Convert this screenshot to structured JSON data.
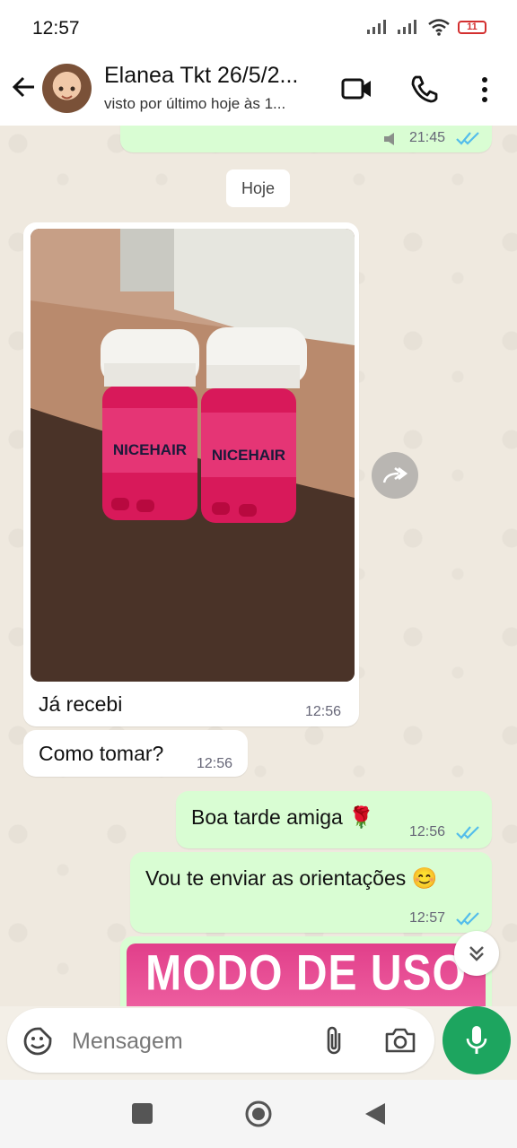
{
  "status_bar": {
    "time": "12:57",
    "battery": "11",
    "icons": [
      "signal-icon",
      "signal-icon",
      "wifi-icon",
      "battery-icon"
    ]
  },
  "header": {
    "contact_name": "Elanea Tkt 26/5/2...",
    "contact_status": "visto por último hoje às 1...",
    "icons": [
      "back-arrow-icon",
      "video-call-icon",
      "phone-icon",
      "more-vert-icon"
    ]
  },
  "chat": {
    "previous_message_time": "21:45",
    "date_separator": "Hoje",
    "messages": [
      {
        "direction": "in",
        "type": "image",
        "caption": "Já recebi",
        "time": "12:56"
      },
      {
        "direction": "in",
        "text": "Como tomar?",
        "time": "12:56"
      },
      {
        "direction": "out",
        "text": "Boa tarde amiga 🌹",
        "time": "12:56",
        "read": true
      },
      {
        "direction": "out",
        "text": "Vou te enviar as orientações 😊",
        "time": "12:57",
        "read": true
      },
      {
        "direction": "out",
        "type": "image",
        "banner_text": "MODO DE USO"
      }
    ],
    "image_product_label": "NICEHAIR"
  },
  "input_bar": {
    "placeholder": "Mensagem",
    "icons": [
      "sticker-icon",
      "attach-icon",
      "camera-icon",
      "mic-icon"
    ]
  },
  "colors": {
    "outgoing_bubble": "#d9fdd3",
    "incoming_bubble": "#ffffff",
    "tick_blue": "#53bdeb",
    "mic_green": "#1da55f",
    "banner_pink": "#e8448f"
  },
  "nav_bar": {
    "icons": [
      "recent-apps-icon",
      "home-icon",
      "back-icon"
    ]
  }
}
